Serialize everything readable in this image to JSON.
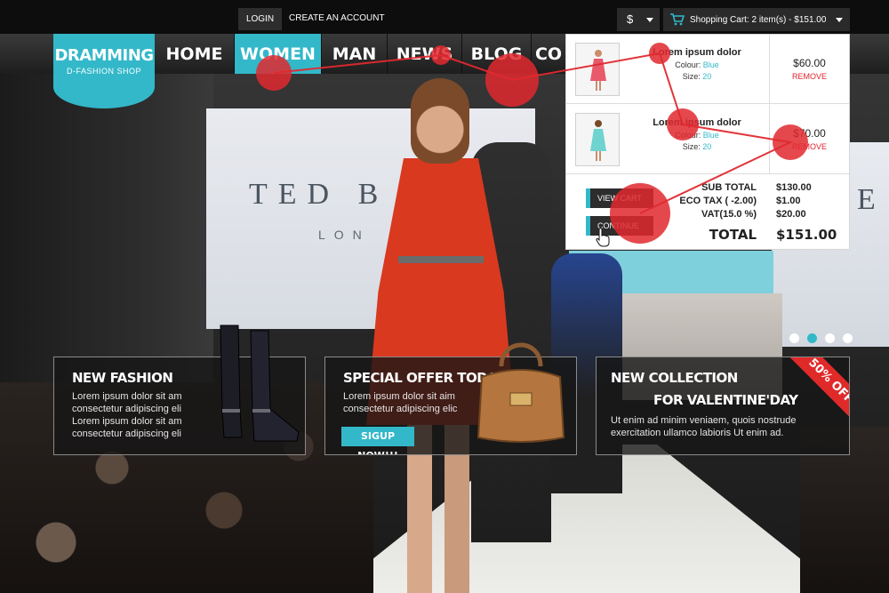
{
  "topbar": {
    "login_label": "LOGIN",
    "create_account_label": "CREATE AN ACCOUNT",
    "currency_symbol": "$",
    "cart_label": "Shopping Cart: 2 item(s) - $151.00"
  },
  "logo": {
    "name": "DRAMMING",
    "tagline": "D-FASHION SHOP"
  },
  "nav": {
    "items": [
      {
        "label": "HOME"
      },
      {
        "label": "WOMEN",
        "active": true
      },
      {
        "label": "MAN"
      },
      {
        "label": "NEWS"
      },
      {
        "label": "BLOG"
      },
      {
        "label": "CO"
      }
    ]
  },
  "hero": {
    "screen_text": "TED B",
    "screen_subtext": "LON",
    "screen_right_text": "E"
  },
  "cart": {
    "items": [
      {
        "name": "Lorem ipsum dolor",
        "colour_label": "Colour:",
        "colour": "Blue",
        "size_label": "Size:",
        "size": "20",
        "price": "$60.00",
        "remove_label": "REMOVE",
        "figure_color": "#e8596a"
      },
      {
        "name": "Lorem ipsum dolor",
        "colour_label": "Colour:",
        "colour": "Blue",
        "size_label": "Size:",
        "size": "20",
        "price": "$70.00",
        "remove_label": "REMOVE",
        "figure_color": "#6fd3d0"
      }
    ],
    "view_cart_label": "VIEW CART",
    "continue_label": "CONTINUE",
    "subtotal_label": "SUB TOTAL",
    "subtotal": "$130.00",
    "eco_tax_label": "ECO TAX ( -2.00)",
    "eco_tax": "$1.00",
    "vat_label": "VAT(15.0 %)",
    "vat": "$20.00",
    "total_label": "TOTAL",
    "total": "$151.00"
  },
  "slider": {
    "dot_count": 4,
    "active_index": 1
  },
  "promos": [
    {
      "title": "NEW FASHION",
      "text": "Lorem ipsum dolor sit am consectetur adipiscing eli Lorem ipsum dolor sit am consectetur adipiscing eli",
      "image_icon": "boots-icon"
    },
    {
      "title": "SPECIAL OFFER TODAY",
      "text": "Lorem ipsum dolor sit aim consectetur adipiscing elic",
      "button_label": "SIGUP NOW!!!",
      "image_icon": "handbag-icon"
    },
    {
      "title_line1": "NEW COLLECTION",
      "title_line2": "FOR VALENTINE'DAY",
      "text": "Ut enim ad minim veniaem, quois nostrude exercitation ullamco labioris Ut enim ad.",
      "ribbon": "50% OFF"
    }
  ],
  "colors": {
    "accent": "#32b8c9",
    "remove_red": "#e0232c",
    "gaze_red": "#e0292f"
  }
}
